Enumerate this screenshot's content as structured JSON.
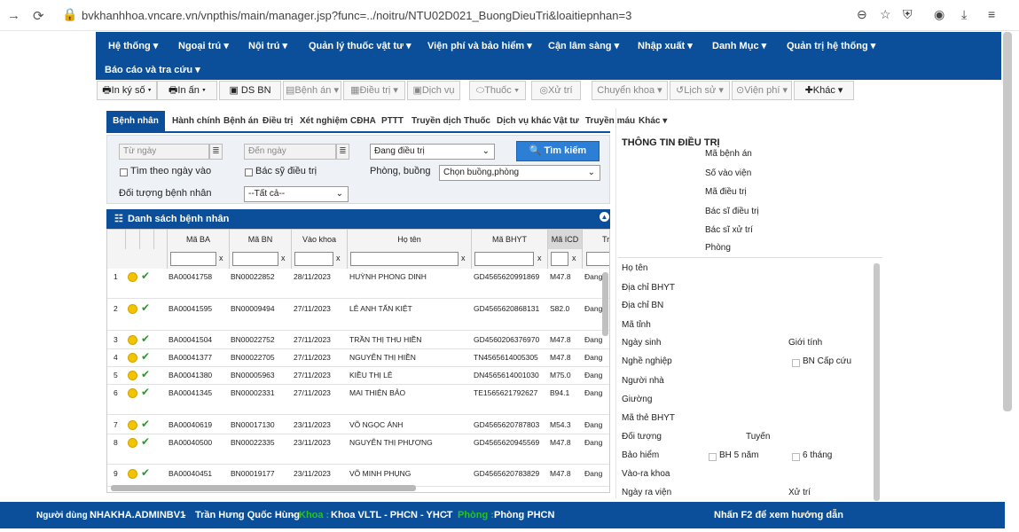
{
  "browser": {
    "url": "bvkhanhhoa.vncare.vn/vnpthis/main/manager.jsp?func=../noitru/NTU02D021_BuongDieuTri&loaitiepnhan=3",
    "icons": [
      "back-icon",
      "reload-icon",
      "lock-icon",
      "zoom-icon",
      "star-icon",
      "shield-icon",
      "account-icon",
      "download-icon",
      "menu-icon"
    ]
  },
  "mainnav": [
    "Hệ thống ▾",
    "Ngoại trú ▾",
    "Nội trú ▾",
    "Quản lý thuốc vật tư ▾",
    "Viện phí và bảo hiểm ▾",
    "Cận lâm sàng ▾",
    "Nhập xuất ▾",
    "Danh Mục ▾",
    "Quản trị hệ thống ▾",
    "Báo cáo và tra cứu ▾"
  ],
  "toolbar": [
    "In ký số ▾",
    "In ấn ▾",
    "DS BN",
    "Bệnh án ▾",
    "Điều trị ▾",
    "Dịch vụ",
    "Thuốc ▾",
    "Xử trí",
    "Chuyển khoa ▾",
    "Lịch sử ▾",
    "Viện phí ▾",
    "Khác ▾"
  ],
  "tabs": [
    "Bệnh nhân",
    "Hành chính",
    "Bệnh án",
    "Điều trị",
    "Xét nghiệm",
    "CĐHA",
    "PTTT",
    "Truyền dịch",
    "Thuốc",
    "Dịch vụ khác",
    "Vật tư",
    "Truyền máu",
    "Khác ▾"
  ],
  "filter": {
    "from_placeholder": "Từ ngày",
    "to_placeholder": "Đến ngày",
    "status": "Đang điều trị",
    "search_button": "Tìm kiếm",
    "by_date": "Tìm theo ngày vào",
    "by_doctor": "Bác sỹ điều trị",
    "room_label": "Phòng, buồng",
    "room_select": "Chọn buồng,phòng",
    "patient_type_label": "Đối tượng bệnh nhân",
    "patient_type": "--Tất cả--",
    "x": "x"
  },
  "list": {
    "title": "Danh sách bệnh nhân",
    "columns": [
      "Mã BA",
      "Mã BN",
      "Vào khoa",
      "Họ tên",
      "Mã BHYT",
      "Mã ICD",
      "Tra"
    ],
    "rows": [
      {
        "n": "1",
        "ba": "BA00041758",
        "bn": "BN00022852",
        "date": "28/11/2023",
        "name": "HUỲNH PHONG DINH",
        "bhyt": "GD4565620991869",
        "icd": "M47.8",
        "st": "Đang"
      },
      {
        "n": "2",
        "ba": "BA00041595",
        "bn": "BN00009494",
        "date": "27/11/2023",
        "name": "LÊ ANH TẤN KIỆT",
        "bhyt": "GD4565620868131",
        "icd": "S82.0",
        "st": "Đang"
      },
      {
        "n": "3",
        "ba": "BA00041504",
        "bn": "BN00022752",
        "date": "27/11/2023",
        "name": "TRẦN THỊ THU HIỀN",
        "bhyt": "GD4560206376970",
        "icd": "M47.8",
        "st": "Đang"
      },
      {
        "n": "4",
        "ba": "BA00041377",
        "bn": "BN00022705",
        "date": "27/11/2023",
        "name": "NGUYỄN THỊ HIỀN",
        "bhyt": "TN4565614005305",
        "icd": "M47.8",
        "st": "Đang"
      },
      {
        "n": "5",
        "ba": "BA00041380",
        "bn": "BN00005963",
        "date": "27/11/2023",
        "name": "KIỀU THỊ LÊ",
        "bhyt": "DN4565614001030",
        "icd": "M75.0",
        "st": "Đang"
      },
      {
        "n": "6",
        "ba": "BA00041345",
        "bn": "BN00002331",
        "date": "27/11/2023",
        "name": "MAI THIỆN BẢO",
        "bhyt": "TE1565621792627",
        "icd": "B94.1",
        "st": "Đang"
      },
      {
        "n": "7",
        "ba": "BA00040619",
        "bn": "BN00017130",
        "date": "23/11/2023",
        "name": "VÕ NGỌC ÁNH",
        "bhyt": "GD4565620787803",
        "icd": "M54.3",
        "st": "Đang"
      },
      {
        "n": "8",
        "ba": "BA00040500",
        "bn": "BN00022335",
        "date": "23/11/2023",
        "name": "NGUYỄN THỊ PHƯỢNG",
        "bhyt": "GD4565620945569",
        "icd": "M47.8",
        "st": "Đang"
      },
      {
        "n": "9",
        "ba": "BA00040451",
        "bn": "BN00019177",
        "date": "23/11/2023",
        "name": "VÕ MINH PHỤNG",
        "bhyt": "GD4565620783829",
        "icd": "M47.8",
        "st": "Đang"
      }
    ]
  },
  "info": {
    "title": "THÔNG TIN ĐIỀU TRỊ",
    "top_labels": [
      "Mã bệnh án",
      "Số vào viện",
      "Mã điều trị",
      "Bác sĩ điều trị",
      "Bác sĩ xử trí",
      "Phòng"
    ],
    "labels": {
      "ho_ten": "Họ tên",
      "dc_bhyt": "Địa chỉ BHYT",
      "dc_bn": "Địa chỉ BN",
      "ma_tinh": "Mã tỉnh",
      "ngay_sinh": "Ngày sinh",
      "gioi_tinh": "Giới tính",
      "nghe": "Nghề nghiệp",
      "bn_cap_cuu": "BN Cấp cứu",
      "nguoi_nha": "Người nhà",
      "giuong": "Giường",
      "ma_the": "Mã thẻ BHYT",
      "doi_tuong": "Đối tượng",
      "tuyen": "Tuyến",
      "bao_hiem": "Bảo hiểm",
      "bh5": "BH 5 năm",
      "sau_thang": "6 tháng",
      "vao_ra": "Vào-ra khoa",
      "ngay_ra": "Ngày ra viện",
      "xu_tri": "Xử trí"
    }
  },
  "status": {
    "user_label": "Người dùng :",
    "user": "NHAKHA.ADMINBV1",
    "sep": "-",
    "fullname": "Trần Hưng Quốc Hùng",
    "khoa_label": "Khoa :",
    "khoa": "Khoa VLTL - PHCN - YHCT",
    "phong_label": "Phòng :",
    "phong": "Phòng PHCN",
    "help": "Nhấn F2 để xem hướng dẫn"
  },
  "colors": {
    "primary": "#0b4f9a",
    "highlight": "#23c423"
  }
}
